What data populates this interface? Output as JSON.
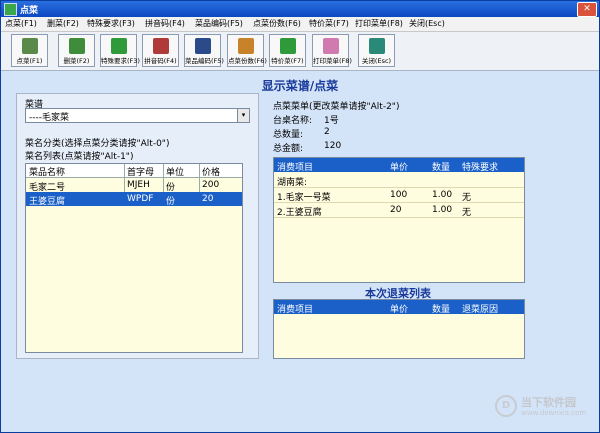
{
  "window": {
    "title": "点菜",
    "close_glyph": "✕"
  },
  "menu": [
    "点菜(F1)",
    "删菜(F2)",
    "特殊要求(F3)",
    "拼音码(F4)",
    "菜品编码(F5)",
    "点菜份数(F6)",
    "特价菜(F7)",
    "打印菜单(F8)",
    "关闭(Esc)"
  ],
  "toolbar": [
    {
      "label": "点菜(F1)",
      "icon": "order-icon",
      "color": "#5a8a4a"
    },
    {
      "label": "删菜(F2)",
      "icon": "delete-icon",
      "color": "#3f8c3a"
    },
    {
      "label": "特殊要求(F3)",
      "icon": "special-icon",
      "color": "#2e9a3a"
    },
    {
      "label": "拼音码(F4)",
      "icon": "pinyin-icon",
      "color": "#b03a3a"
    },
    {
      "label": "菜品编码(F5)",
      "icon": "code-icon",
      "color": "#2a4a8a"
    },
    {
      "label": "点菜份数(F6)",
      "icon": "portions-icon",
      "color": "#c8822a"
    },
    {
      "label": "特价菜(F7)",
      "icon": "discount-icon",
      "color": "#2e9a3a"
    },
    {
      "label": "打印菜单(F8)",
      "icon": "print-icon",
      "color": "#d07ab0"
    },
    {
      "label": "关闭(Esc)",
      "icon": "exit-icon",
      "color": "#2a8a7a"
    }
  ],
  "main_title": "显示菜谱/点菜",
  "left": {
    "recipe_label": "菜谱",
    "recipe_value": "----毛家菜",
    "recipe_arrow": "▾",
    "category_hint": "菜名分类(选择点菜分类请按\"Alt-0\")",
    "list_hint": "菜名列表(点菜请按\"Alt-1\")",
    "columns": [
      "菜品名称",
      "首字母",
      "单位",
      "价格"
    ],
    "rows": [
      [
        "毛家二号",
        "MJEH",
        "份",
        "200"
      ],
      [
        "王婆豆腐",
        "WPDF",
        "份",
        "20"
      ]
    ],
    "selected_row": 1
  },
  "right": {
    "order_hint": "点菜菜单(更改菜单请按\"Alt-2\")",
    "table_label": "台桌名称:",
    "table_value": "1号",
    "qty_label": "总数量:",
    "qty_value": "2",
    "amount_label": "总金额:",
    "amount_value": "120",
    "columns": [
      "消费项目",
      "单价",
      "数量",
      "特殊要求"
    ],
    "group": "湖南菜:",
    "rows": [
      [
        "1.毛家一号菜",
        "100",
        "1.00",
        "无"
      ],
      [
        "2.王婆豆腐",
        "20",
        "1.00",
        "无"
      ]
    ],
    "refund_title": "本次退菜列表",
    "refund_columns": [
      "消费项目",
      "单价",
      "数量",
      "退菜原因"
    ]
  },
  "watermark": {
    "glyph": "D",
    "line1": "当下软件园",
    "line2": "www.downxia.com"
  }
}
